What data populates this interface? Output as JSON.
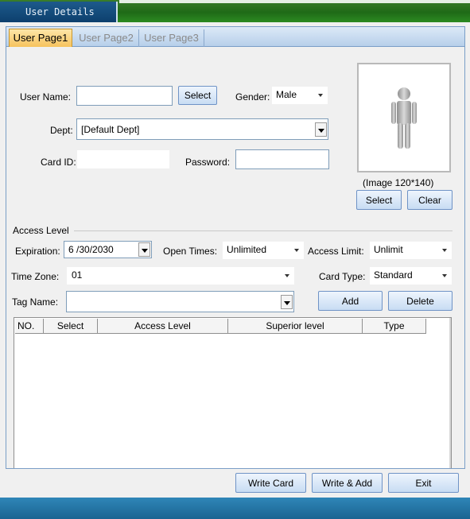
{
  "window": {
    "title": "User Details"
  },
  "tabs": [
    "User Page1",
    "User Page2",
    "User Page3"
  ],
  "user": {
    "name_label": "User Name:",
    "name_value": "",
    "select_label": "Select",
    "gender_label": "Gender:",
    "gender_value": "Male",
    "dept_label": "Dept:",
    "dept_value": "[Default Dept]",
    "card_id_label": "Card ID:",
    "card_id_value": "",
    "password_label": "Password:",
    "password_value": ""
  },
  "photo": {
    "caption": "(Image 120*140)",
    "select_label": "Select",
    "clear_label": "Clear"
  },
  "access": {
    "section_title": "Access Level",
    "expiration_label": "Expiration:",
    "expiration_value": "6 /30/2030",
    "open_times_label": "Open Times:",
    "open_times_value": "Unlimited",
    "access_limit_label": "Access Limit:",
    "access_limit_value": "Unlimit",
    "time_zone_label": "Time Zone:",
    "time_zone_value": "01",
    "card_type_label": "Card Type:",
    "card_type_value": "Standard",
    "tag_name_label": "Tag Name:",
    "tag_name_value": "",
    "add_label": "Add",
    "delete_label": "Delete"
  },
  "table": {
    "columns": [
      "NO.",
      "Select",
      "Access Level",
      "Superior level",
      "Type"
    ],
    "rows": []
  },
  "footer": {
    "write_card_label": "Write Card",
    "write_add_label": "Write & Add",
    "exit_label": "Exit"
  }
}
